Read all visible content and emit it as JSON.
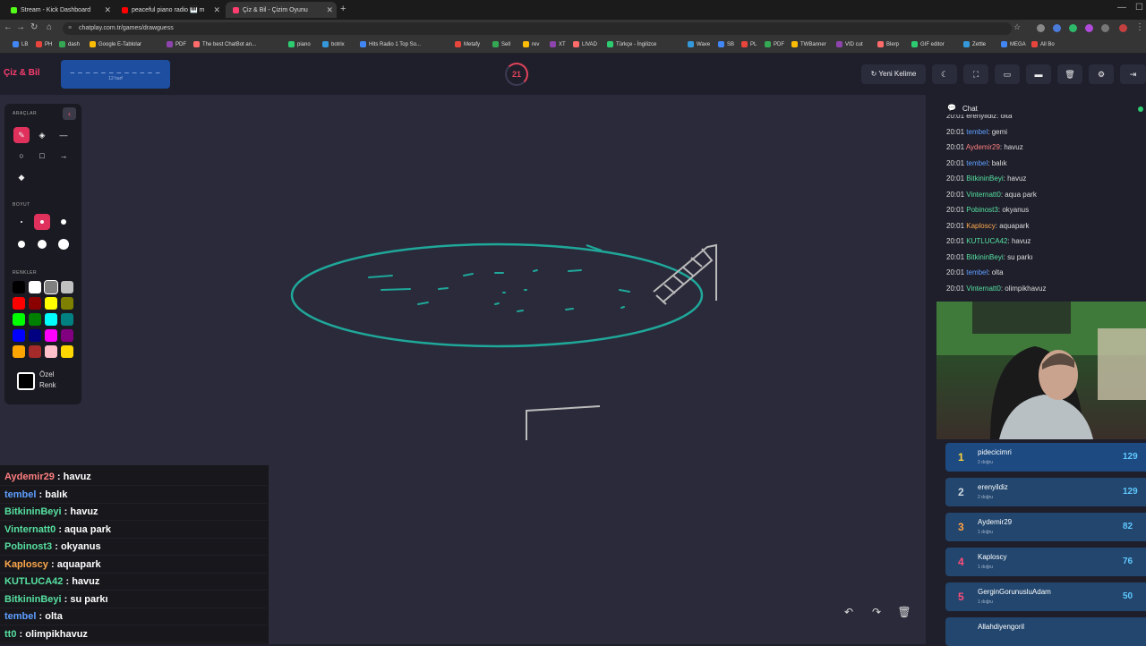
{
  "browser": {
    "tabs": [
      {
        "title": "Stream - Kick Dashboard",
        "color": "#53fc18"
      },
      {
        "title": "peaceful piano radio 🎹 m",
        "color": "#ff0000"
      },
      {
        "title": "Çiz & Bil - Çizim Oyunu",
        "color": "#ff3d6e"
      }
    ],
    "url": "chatplay.com.tr/games/drawguess",
    "bookmarks": [
      "LB",
      "PH",
      "dash",
      "Google E-Tablolar",
      "PDF",
      "The best ChatBot an...",
      "piano",
      "botrix",
      "Hits Radio 1 Top So...",
      "Metafy",
      "Sell",
      "rev",
      "XT",
      "LIVAD",
      "Türkçe - İngilizce",
      "Wave",
      "SB",
      "PL",
      "PDF",
      "TWBanner",
      "VID cut",
      "Blerp",
      "GIF editor",
      "Zettle",
      "MEGA",
      "All Bo"
    ]
  },
  "header": {
    "logo": "Çiz & Bil",
    "word_dashes": "_ _ _ _ _ _ _ _ _ _ _ _",
    "word_length": "12 harf",
    "timer": "21",
    "new_word_label": "Yeni Kelime"
  },
  "tools": {
    "title": "ARAÇLAR",
    "size_title": "BOYUT",
    "colors_title": "RENKLER",
    "custom_color_line1": "Özel",
    "custom_color_line2": "Renk",
    "palette": [
      "#000000",
      "#ffffff",
      "#808080",
      "#c0c0c0",
      "#ff0000",
      "#8b0000",
      "#ffff00",
      "#808000",
      "#00ff00",
      "#008000",
      "#00ffff",
      "#008080",
      "#0000ff",
      "#000080",
      "#ff00ff",
      "#800080",
      "#ffa500",
      "#a52a2a",
      "#ffc0cb",
      "#ffd700"
    ],
    "selected_color_index": 2
  },
  "overlay_chat": [
    {
      "user": "Aydemir29",
      "msg": "havuz",
      "color": "#ff7f7f"
    },
    {
      "user": "tembel",
      "msg": "balık",
      "color": "#5f9fff"
    },
    {
      "user": "BitkininBeyi",
      "msg": "havuz",
      "color": "#57e0a0"
    },
    {
      "user": "Vinternatt0",
      "msg": "aqua park",
      "color": "#57e0a0"
    },
    {
      "user": "Pobinost3",
      "msg": "okyanus",
      "color": "#57e0a0"
    },
    {
      "user": "Kaploscy",
      "msg": "aquapark",
      "color": "#ffa94d"
    },
    {
      "user": "KUTLUCA42",
      "msg": "havuz",
      "color": "#57e0a0"
    },
    {
      "user": "BitkininBeyi",
      "msg": "su parkı",
      "color": "#57e0a0"
    },
    {
      "user": "tembel",
      "msg": "olta",
      "color": "#5f9fff"
    },
    {
      "user": "tt0",
      "msg": "olimpikhavuz",
      "color": "#57e0a0"
    }
  ],
  "chat": {
    "title": "Chat",
    "messages": [
      {
        "time": "20:01",
        "user": "erenyildiz",
        "msg": "olta",
        "color": "#dddddd"
      },
      {
        "time": "20:01",
        "user": "tembel",
        "msg": "gemi",
        "color": "#5f9fff"
      },
      {
        "time": "20:01",
        "user": "Aydemir29",
        "msg": "havuz",
        "color": "#ff7f7f"
      },
      {
        "time": "20:01",
        "user": "tembel",
        "msg": "balık",
        "color": "#5f9fff"
      },
      {
        "time": "20:01",
        "user": "BitkininBeyi",
        "msg": "havuz",
        "color": "#57e0a0"
      },
      {
        "time": "20:01",
        "user": "Vinternatt0",
        "msg": "aqua park",
        "color": "#57e0a0"
      },
      {
        "time": "20:01",
        "user": "Pobinost3",
        "msg": "okyanus",
        "color": "#57e0a0"
      },
      {
        "time": "20:01",
        "user": "Kaploscy",
        "msg": "aquapark",
        "color": "#ffa94d"
      },
      {
        "time": "20:01",
        "user": "KUTLUCA42",
        "msg": "havuz",
        "color": "#57e0a0"
      },
      {
        "time": "20:01",
        "user": "BitkininBeyi",
        "msg": "su parkı",
        "color": "#57e0a0"
      },
      {
        "time": "20:01",
        "user": "tembel",
        "msg": "olta",
        "color": "#5f9fff"
      },
      {
        "time": "20:01",
        "user": "Vinternatt0",
        "msg": "olimpikhavuz",
        "color": "#57e0a0"
      }
    ]
  },
  "leaderboard": [
    {
      "rank": "1",
      "name": "pidecicimri",
      "sub": "2 doğru",
      "points": "129",
      "rank_color": "#ffd43b"
    },
    {
      "rank": "2",
      "name": "erenyildiz",
      "sub": "2 doğru",
      "points": "129",
      "rank_color": "#d0d8e0"
    },
    {
      "rank": "3",
      "name": "Aydemir29",
      "sub": "1 doğru",
      "points": "82",
      "rank_color": "#ff9f43"
    },
    {
      "rank": "4",
      "name": "Kaploscy",
      "sub": "1 doğru",
      "points": "76",
      "rank_color": "#ff4d7a"
    },
    {
      "rank": "5",
      "name": "GerginGorunusluAdam",
      "sub": "1 doğru",
      "points": "50",
      "rank_color": "#ff4d7a"
    },
    {
      "rank": "",
      "name": "Allahdiyengoril",
      "sub": "",
      "points": "",
      "rank_color": "#ff4d7a"
    }
  ]
}
